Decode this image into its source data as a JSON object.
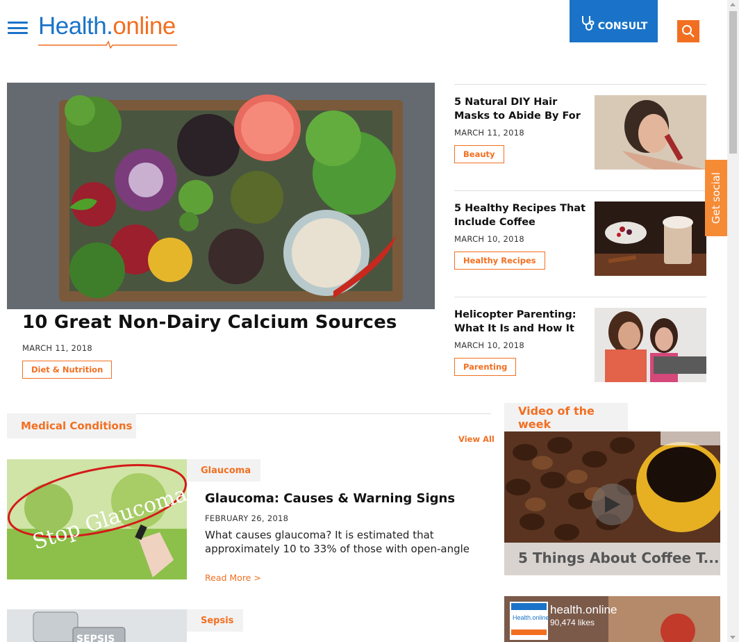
{
  "header": {
    "logo_health": "Health",
    "logo_online": "online",
    "consult_label": "CONSULT"
  },
  "get_social": "Get social",
  "featured": {
    "title": "10 Great Non-Dairy Calcium Sources",
    "date": "MARCH 11, 2018",
    "tag": "Diet & Nutrition"
  },
  "side_articles": [
    {
      "title": "5 Natural DIY Hair Masks to Abide By For",
      "date": "MARCH 11, 2018",
      "tag": "Beauty"
    },
    {
      "title": "5 Healthy Recipes That Include Coffee",
      "date": "MARCH 10, 2018",
      "tag": "Healthy Recipes"
    },
    {
      "title": "Helicopter Parenting: What It Is and How It",
      "date": "MARCH 10, 2018",
      "tag": "Parenting"
    }
  ],
  "medical": {
    "heading": "Medical Conditions",
    "view_all": "View All",
    "articles": [
      {
        "category": "Glaucoma",
        "title": "Glaucoma: Causes & Warning Signs",
        "date": "FEBRUARY 26, 2018",
        "description": "What causes glaucoma? It is estimated that approximately 10 to 33% of those with open-angle",
        "read_more": "Read More >",
        "image_text": "Stop Glaucoma"
      },
      {
        "category": "Sepsis",
        "image_text": "SEPSIS"
      }
    ]
  },
  "video": {
    "heading": "Video of the week",
    "caption": "5 Things About Coffee T..."
  },
  "facebook": {
    "name": "health.online",
    "likes": "90,474 likes"
  },
  "watermark": "Health.online",
  "colors": {
    "brand_blue": "#1a73c8",
    "brand_orange": "#f26f21"
  }
}
